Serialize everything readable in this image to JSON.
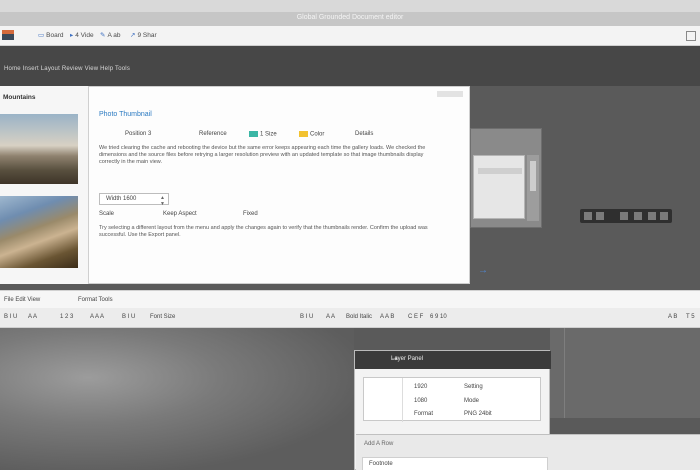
{
  "window": {
    "title": "Global Grounded Document editor"
  },
  "toolbar": {
    "items": [
      {
        "label": "Board"
      },
      {
        "label": "4 Vide"
      },
      {
        "label": "A ab"
      },
      {
        "label": "9 Shar"
      }
    ]
  },
  "menubar": {
    "text": "Home Insert Layout Review View Help Tools"
  },
  "left_panel": {
    "heading": "Mountains"
  },
  "dialog": {
    "title": "Photo Thumbnail",
    "fields": [
      "Position 3",
      "Reference",
      "1 Size",
      "Color",
      "Details"
    ],
    "paragraph1": "We tried clearing the cache and rebooting the device but the same error keeps appearing each time the gallery loads. We checked the dimensions and the source files before retrying a larger resolution preview with an updated template so that image thumbnails display correctly in the main view.",
    "stepper_value": "Width 1600",
    "row3": [
      "Scale",
      "Keep Aspect",
      "Fixed"
    ],
    "paragraph2": "Try selecting a different layout from the menu and apply the changes again to verify that the thumbnails render. Confirm the upload was successful. Use the Export panel."
  },
  "lower_bar": {
    "items": [
      "File Edit View",
      "Format Tools"
    ]
  },
  "icon_bar": {
    "items": [
      "B I U",
      "A A",
      "1 2 3",
      "A A A",
      "B I U",
      "Font Size",
      "B I U",
      "A A",
      "Bold Italic",
      "A A B",
      "C E F",
      "6 9 10",
      "A B",
      "T 5"
    ]
  },
  "dark_panel": {
    "title": "Layer Panel",
    "rows": [
      {
        "key": "1920",
        "value": "Setting"
      },
      {
        "key": "1080",
        "value": "Mode"
      },
      {
        "key": "Format",
        "value": "PNG 24bit"
      }
    ]
  },
  "under_panel": {
    "label": "Add A Row",
    "sheet": "Footnote"
  }
}
